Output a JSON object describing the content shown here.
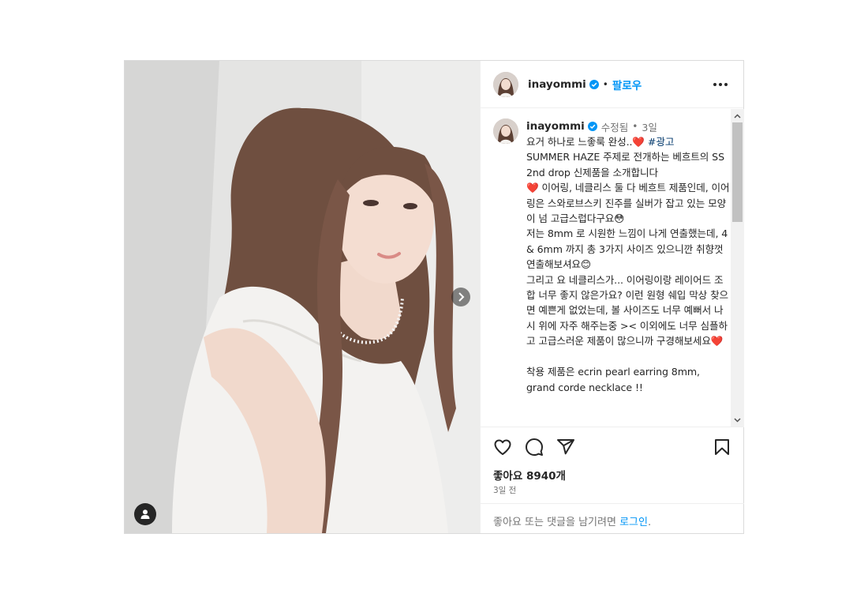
{
  "post": {
    "author": {
      "username": "inayommi",
      "follow_label": "팔로우",
      "separator": "•",
      "icons": {
        "verified": "verified-badge-icon",
        "more": "more-options-icon"
      }
    },
    "caption": {
      "username": "inayommi",
      "edited_label": "수정됨",
      "separator": "•",
      "age": "3일",
      "text_part1": "요거 하나로 느좋룩 완성..",
      "heart1": "❤️",
      "hashtag": "#광고",
      "text_part2": "\nSUMMER HAZE 주제로 전개하는 베흐트의 SS 2nd drop 신제품을 소개합니다",
      "heart2": "❤️",
      "text_part3": " 이어링, 네클리스 둘 다 베흐트 제품인데, 이어링은 스와로브스키 진주를 실버가 잡고 있는 모양이 넘 고급스럽다구요😳\n저는 8mm 로 시원한 느낌이 나게 연출했는데, 4 & 6mm 까지 총 3가지 사이즈 있으니깐 취향껏 연출해보셔요😊\n그리고 요 네클리스가... 이어링이랑 레이어드 조합 너무 좋지 않은가요? 이런 원형 쉐입 막상 찾으면 예쁜게 없었는데, 볼 사이즈도 너무 예뻐서 나시 위에 자주 해주는중 >< 이외에도 너무 심플하고 고급스러운 제품이 많으니까 구경해보세요",
      "heart3": "❤️",
      "text_part4": "\n\n착용 제품은 ecrin pearl earring 8mm, grand corde necklace !!"
    },
    "actions": {
      "icons": [
        "heart-icon",
        "comment-icon",
        "share-icon",
        "bookmark-icon"
      ]
    },
    "likes_label": "좋아요 8940개",
    "posted_ago": "3일 전",
    "login_prompt": {
      "prefix": "좋아요 또는 댓글을 남기려면 ",
      "link": "로그인",
      "suffix": "."
    },
    "media": {
      "icons": {
        "next": "chevron-right-icon",
        "user_tags": "user-tag-icon"
      }
    },
    "colors": {
      "accent": "#0095f6",
      "heart": "#e0245e",
      "text": "#262626",
      "muted": "#737373"
    }
  }
}
